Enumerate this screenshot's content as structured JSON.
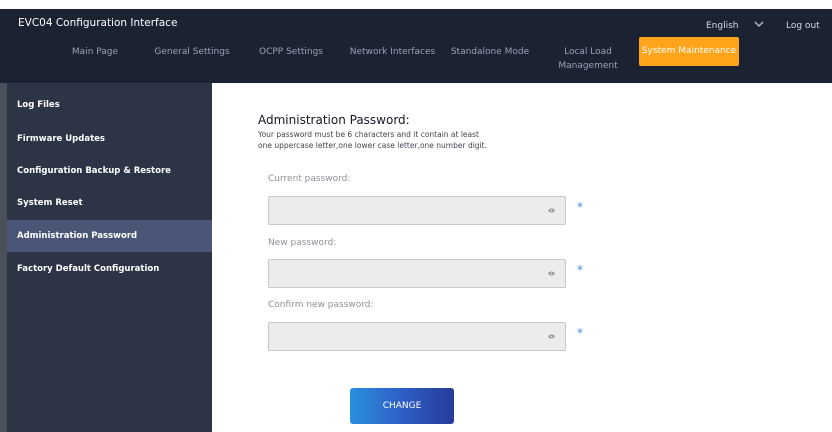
{
  "header": {
    "title": "EVC04 Configuration Interface",
    "language": "English",
    "logout_label": "Log out"
  },
  "nav": {
    "items": [
      {
        "label": "Main Page"
      },
      {
        "label": "General Settings"
      },
      {
        "label": "OCPP Settings"
      },
      {
        "label": "Network Interfaces"
      },
      {
        "label": "Standalone Mode"
      },
      {
        "label": "Local Load Management"
      },
      {
        "label": "System Maintenance",
        "active": true
      }
    ]
  },
  "sidebar": {
    "items": [
      {
        "label": "Log Files"
      },
      {
        "label": "Firmware Updates"
      },
      {
        "label": "Configuration Backup & Restore"
      },
      {
        "label": "System Reset"
      },
      {
        "label": "Administration Password",
        "active": true
      },
      {
        "label": "Factory Default Configuration"
      }
    ]
  },
  "main": {
    "title": "Administration Password:",
    "description_line1": "Your password must be 6 characters and it contain at least",
    "description_line2": "one uppercase letter,one lower case letter,one number digit.",
    "fields": [
      {
        "label": "Current password:",
        "value": "",
        "required_mark": "*"
      },
      {
        "label": "New password:",
        "value": "",
        "required_mark": "*"
      },
      {
        "label": "Confirm new password:",
        "value": "",
        "required_mark": "*"
      }
    ],
    "change_label": "CHANGE"
  },
  "colors": {
    "header_bg": "#1b2232",
    "sidebar_bg": "#2c3446",
    "sidebar_active": "#4a5677",
    "nav_active": "#ffa41b",
    "required_star": "#4a90d9",
    "button_start": "#2a8fe0",
    "button_end": "#243c9a"
  }
}
